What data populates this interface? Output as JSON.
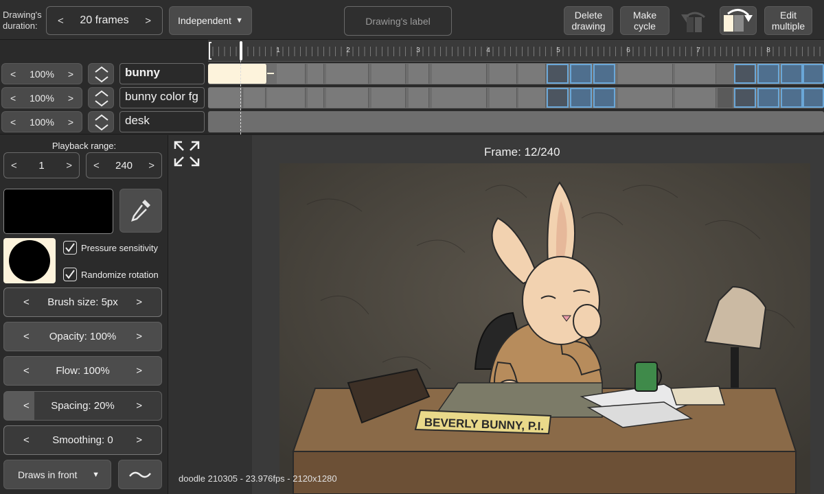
{
  "toolbar": {
    "duration_label": "Drawing's duration:",
    "duration_value": "20 frames",
    "mode_value": "Independent",
    "drawing_label_placeholder": "Drawing's label",
    "delete_label": "Delete drawing",
    "cycle_label": "Make cycle",
    "edit_multiple_label": "Edit multiple"
  },
  "timeline": {
    "ruler_numbers": [
      "1",
      "2",
      "3",
      "4",
      "5",
      "6",
      "7",
      "8"
    ],
    "layers": [
      {
        "opacity": "100%",
        "name": "bunny"
      },
      {
        "opacity": "100%",
        "name": "bunny color fg"
      },
      {
        "opacity": "100%",
        "name": "desk"
      }
    ]
  },
  "panel": {
    "playback_label": "Playback range:",
    "range_start": "1",
    "range_end": "240",
    "pressure_label": "Pressure sensitivity",
    "randomize_label": "Randomize rotation",
    "brush_size": "Brush size: 5px",
    "opacity": "Opacity: 100%",
    "flow": "Flow: 100%",
    "spacing": "Spacing: 20%",
    "smoothing": "Smoothing: 0",
    "draw_mode": "Draws in front"
  },
  "canvas": {
    "frame_readout": "Frame: 12/240",
    "status": "doodle 210305 - 23.976fps - 2120x1280",
    "nameplate": "BEVERLY BUNNY, P.I."
  },
  "colors": {
    "selection": "#6aa7d8",
    "current_drawing": "#fdf3dc",
    "brush_color": "#000000"
  }
}
